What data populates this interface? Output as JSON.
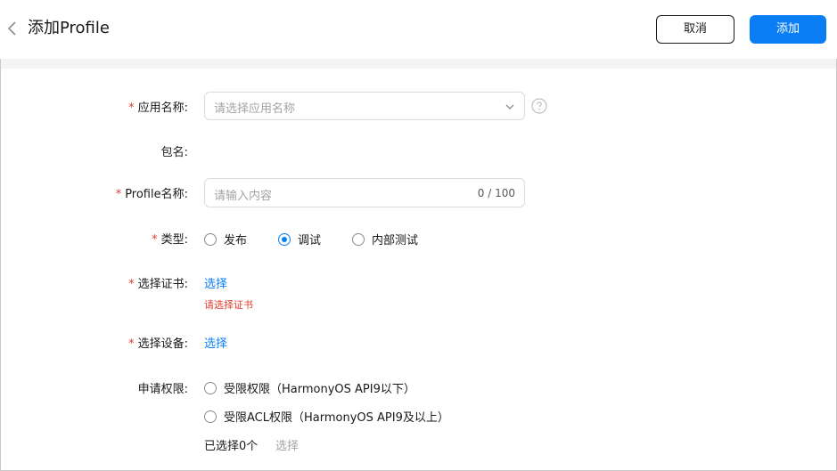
{
  "header": {
    "title": "添加Profile",
    "cancel_label": "取消",
    "add_label": "添加"
  },
  "form": {
    "app_name": {
      "label": "应用名称:",
      "required_mark": "*",
      "placeholder": "请选择应用名称"
    },
    "package": {
      "label": "包名:"
    },
    "profile_name": {
      "label": "Profile名称:",
      "required_mark": "*",
      "placeholder": "请输入内容",
      "counter": "0 / 100"
    },
    "type": {
      "label": "类型:",
      "required_mark": "*",
      "options": [
        "发布",
        "调试",
        "内部测试"
      ],
      "selected": "调试"
    },
    "certificate": {
      "label": "选择证书:",
      "required_mark": "*",
      "action": "选择",
      "error": "请选择证书"
    },
    "device": {
      "label": "选择设备:",
      "required_mark": "*",
      "action": "选择"
    },
    "permissions": {
      "label": "申请权限:",
      "options": [
        "受限权限（HarmonyOS API9以下）",
        "受限ACL权限（HarmonyOS API9及以上）"
      ],
      "selected_count": "已选择0个",
      "action": "选择"
    }
  },
  "colors": {
    "accent": "#0a7ef5",
    "required": "#e23c30",
    "placeholder": "#a3a3a3",
    "band": "#f4f4f4"
  },
  "icons": [
    "back-chevron-icon",
    "dropdown-chevron-icon",
    "help-circle-icon"
  ]
}
